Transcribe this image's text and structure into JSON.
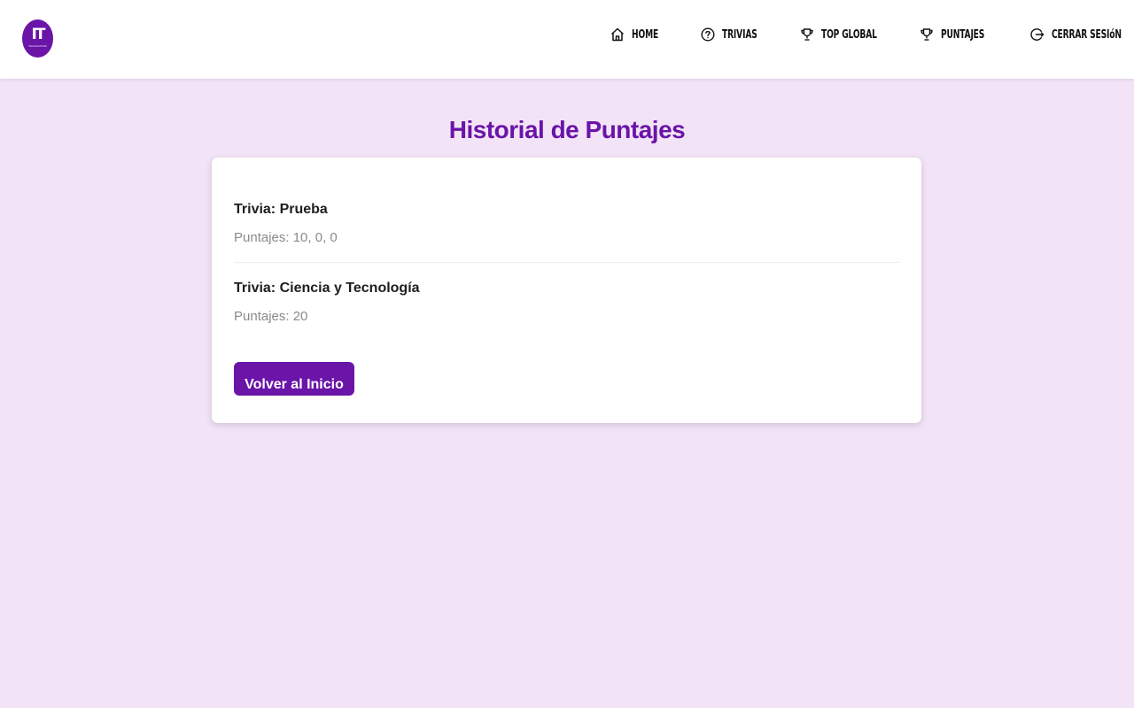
{
  "logo": {
    "mark": "IT",
    "text": "TECHMASTER"
  },
  "nav": {
    "items": [
      {
        "label": "HOME",
        "icon": "home-icon"
      },
      {
        "label": "TRIVIAS",
        "icon": "question-circle-icon"
      },
      {
        "label": "TOP GLOBAL",
        "icon": "trophy-icon"
      },
      {
        "label": "PUNTAJES",
        "icon": "trophy-icon"
      },
      {
        "label": "CERRAR SESIóN",
        "icon": "logout-icon"
      }
    ]
  },
  "page": {
    "title": "Historial de Puntajes"
  },
  "history": [
    {
      "title": "Trivia: Prueba",
      "scores": "Puntajes: 10, 0, 0"
    },
    {
      "title": "Trivia: Ciencia y Tecnología",
      "scores": "Puntajes: 20"
    }
  ],
  "actions": {
    "back_label": "Volver al Inicio"
  },
  "colors": {
    "accent": "#6a14a8",
    "background": "#f2e4f6",
    "card": "#ffffff"
  }
}
